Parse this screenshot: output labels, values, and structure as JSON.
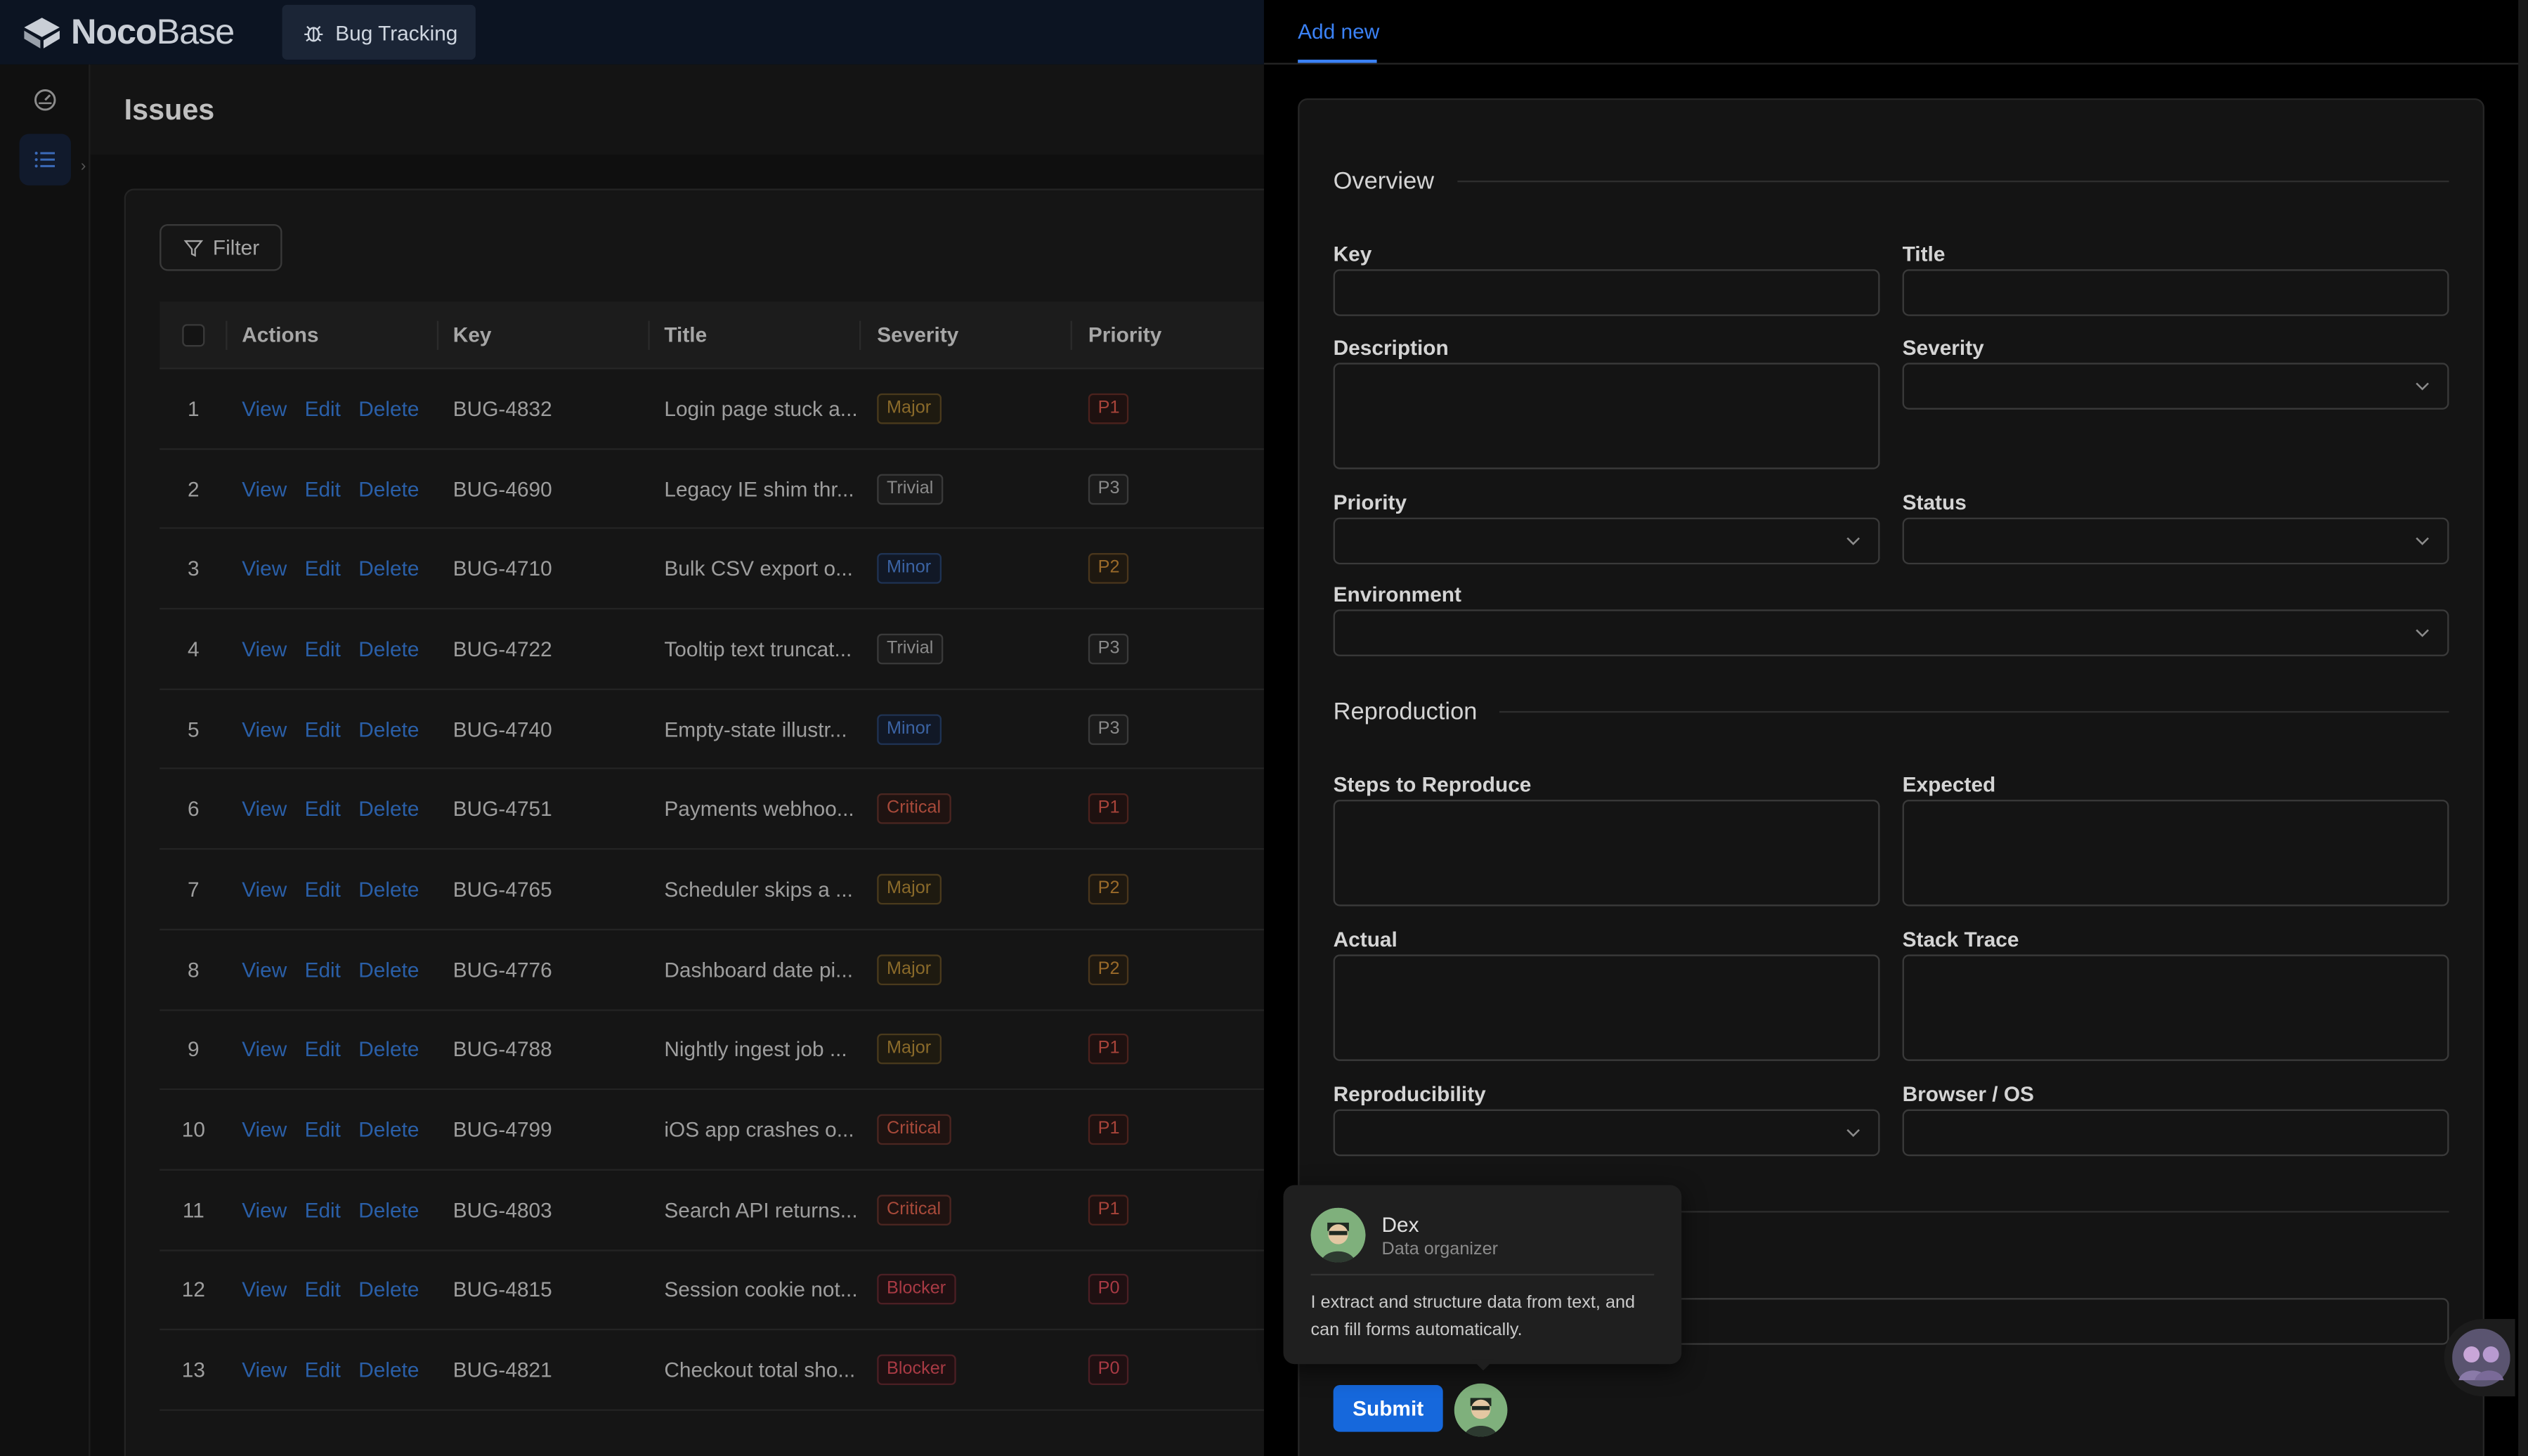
{
  "app": {
    "logo_bold": "Noco",
    "logo_light": "Base",
    "tab_label": "Bug Tracking"
  },
  "page": {
    "title": "Issues",
    "filter_label": "Filter"
  },
  "table": {
    "headers": {
      "actions": "Actions",
      "key": "Key",
      "title": "Title",
      "severity": "Severity",
      "priority": "Priority"
    },
    "action_labels": {
      "view": "View",
      "edit": "Edit",
      "delete": "Delete"
    },
    "rows": [
      {
        "num": "1",
        "key": "BUG-4832",
        "title": "Login page stuck a...",
        "severity": "Major",
        "priority": "P1"
      },
      {
        "num": "2",
        "key": "BUG-4690",
        "title": "Legacy IE shim thr...",
        "severity": "Trivial",
        "priority": "P3"
      },
      {
        "num": "3",
        "key": "BUG-4710",
        "title": "Bulk CSV export o...",
        "severity": "Minor",
        "priority": "P2"
      },
      {
        "num": "4",
        "key": "BUG-4722",
        "title": "Tooltip text truncat...",
        "severity": "Trivial",
        "priority": "P3"
      },
      {
        "num": "5",
        "key": "BUG-4740",
        "title": "Empty-state illustr...",
        "severity": "Minor",
        "priority": "P3"
      },
      {
        "num": "6",
        "key": "BUG-4751",
        "title": "Payments webhoo...",
        "severity": "Critical",
        "priority": "P1"
      },
      {
        "num": "7",
        "key": "BUG-4765",
        "title": "Scheduler skips a ...",
        "severity": "Major",
        "priority": "P2"
      },
      {
        "num": "8",
        "key": "BUG-4776",
        "title": "Dashboard date pi...",
        "severity": "Major",
        "priority": "P2"
      },
      {
        "num": "9",
        "key": "BUG-4788",
        "title": "Nightly ingest job ...",
        "severity": "Major",
        "priority": "P1"
      },
      {
        "num": "10",
        "key": "BUG-4799",
        "title": "iOS app crashes o...",
        "severity": "Critical",
        "priority": "P1"
      },
      {
        "num": "11",
        "key": "BUG-4803",
        "title": "Search API returns...",
        "severity": "Critical",
        "priority": "P1"
      },
      {
        "num": "12",
        "key": "BUG-4815",
        "title": "Session cookie not...",
        "severity": "Blocker",
        "priority": "P0"
      },
      {
        "num": "13",
        "key": "BUG-4821",
        "title": "Checkout total sho...",
        "severity": "Blocker",
        "priority": "P0"
      }
    ]
  },
  "drawer": {
    "tab_label": "Add new",
    "sections": {
      "overview": "Overview",
      "reproduction": "Reproduction"
    },
    "fields": {
      "key": "Key",
      "title": "Title",
      "description": "Description",
      "severity": "Severity",
      "priority": "Priority",
      "status": "Status",
      "environment": "Environment",
      "steps": "Steps to Reproduce",
      "expected": "Expected",
      "actual": "Actual",
      "stack_trace": "Stack Trace",
      "reproducibility": "Reproducibility",
      "browser_os": "Browser / OS"
    },
    "submit_label": "Submit"
  },
  "assistant": {
    "name": "Dex",
    "role": "Data organizer",
    "description": "I extract and structure data from text, and can fill forms automatically."
  },
  "colors": {
    "accent": "#1668dc",
    "link": "#2a5fa8",
    "tab_active": "#3b82f6"
  }
}
